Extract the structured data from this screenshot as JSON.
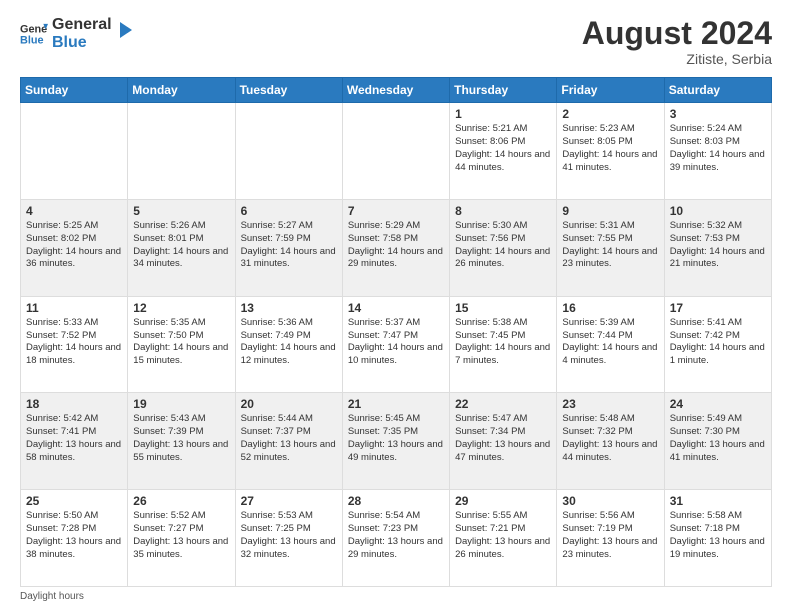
{
  "header": {
    "logo_line1": "General",
    "logo_line2": "Blue",
    "month_year": "August 2024",
    "location": "Zitiste, Serbia"
  },
  "days_of_week": [
    "Sunday",
    "Monday",
    "Tuesday",
    "Wednesday",
    "Thursday",
    "Friday",
    "Saturday"
  ],
  "weeks": [
    [
      {
        "day": "",
        "info": ""
      },
      {
        "day": "",
        "info": ""
      },
      {
        "day": "",
        "info": ""
      },
      {
        "day": "",
        "info": ""
      },
      {
        "day": "1",
        "info": "Sunrise: 5:21 AM\nSunset: 8:06 PM\nDaylight: 14 hours\nand 44 minutes."
      },
      {
        "day": "2",
        "info": "Sunrise: 5:23 AM\nSunset: 8:05 PM\nDaylight: 14 hours\nand 41 minutes."
      },
      {
        "day": "3",
        "info": "Sunrise: 5:24 AM\nSunset: 8:03 PM\nDaylight: 14 hours\nand 39 minutes."
      }
    ],
    [
      {
        "day": "4",
        "info": "Sunrise: 5:25 AM\nSunset: 8:02 PM\nDaylight: 14 hours\nand 36 minutes."
      },
      {
        "day": "5",
        "info": "Sunrise: 5:26 AM\nSunset: 8:01 PM\nDaylight: 14 hours\nand 34 minutes."
      },
      {
        "day": "6",
        "info": "Sunrise: 5:27 AM\nSunset: 7:59 PM\nDaylight: 14 hours\nand 31 minutes."
      },
      {
        "day": "7",
        "info": "Sunrise: 5:29 AM\nSunset: 7:58 PM\nDaylight: 14 hours\nand 29 minutes."
      },
      {
        "day": "8",
        "info": "Sunrise: 5:30 AM\nSunset: 7:56 PM\nDaylight: 14 hours\nand 26 minutes."
      },
      {
        "day": "9",
        "info": "Sunrise: 5:31 AM\nSunset: 7:55 PM\nDaylight: 14 hours\nand 23 minutes."
      },
      {
        "day": "10",
        "info": "Sunrise: 5:32 AM\nSunset: 7:53 PM\nDaylight: 14 hours\nand 21 minutes."
      }
    ],
    [
      {
        "day": "11",
        "info": "Sunrise: 5:33 AM\nSunset: 7:52 PM\nDaylight: 14 hours\nand 18 minutes."
      },
      {
        "day": "12",
        "info": "Sunrise: 5:35 AM\nSunset: 7:50 PM\nDaylight: 14 hours\nand 15 minutes."
      },
      {
        "day": "13",
        "info": "Sunrise: 5:36 AM\nSunset: 7:49 PM\nDaylight: 14 hours\nand 12 minutes."
      },
      {
        "day": "14",
        "info": "Sunrise: 5:37 AM\nSunset: 7:47 PM\nDaylight: 14 hours\nand 10 minutes."
      },
      {
        "day": "15",
        "info": "Sunrise: 5:38 AM\nSunset: 7:45 PM\nDaylight: 14 hours\nand 7 minutes."
      },
      {
        "day": "16",
        "info": "Sunrise: 5:39 AM\nSunset: 7:44 PM\nDaylight: 14 hours\nand 4 minutes."
      },
      {
        "day": "17",
        "info": "Sunrise: 5:41 AM\nSunset: 7:42 PM\nDaylight: 14 hours\nand 1 minute."
      }
    ],
    [
      {
        "day": "18",
        "info": "Sunrise: 5:42 AM\nSunset: 7:41 PM\nDaylight: 13 hours\nand 58 minutes."
      },
      {
        "day": "19",
        "info": "Sunrise: 5:43 AM\nSunset: 7:39 PM\nDaylight: 13 hours\nand 55 minutes."
      },
      {
        "day": "20",
        "info": "Sunrise: 5:44 AM\nSunset: 7:37 PM\nDaylight: 13 hours\nand 52 minutes."
      },
      {
        "day": "21",
        "info": "Sunrise: 5:45 AM\nSunset: 7:35 PM\nDaylight: 13 hours\nand 49 minutes."
      },
      {
        "day": "22",
        "info": "Sunrise: 5:47 AM\nSunset: 7:34 PM\nDaylight: 13 hours\nand 47 minutes."
      },
      {
        "day": "23",
        "info": "Sunrise: 5:48 AM\nSunset: 7:32 PM\nDaylight: 13 hours\nand 44 minutes."
      },
      {
        "day": "24",
        "info": "Sunrise: 5:49 AM\nSunset: 7:30 PM\nDaylight: 13 hours\nand 41 minutes."
      }
    ],
    [
      {
        "day": "25",
        "info": "Sunrise: 5:50 AM\nSunset: 7:28 PM\nDaylight: 13 hours\nand 38 minutes."
      },
      {
        "day": "26",
        "info": "Sunrise: 5:52 AM\nSunset: 7:27 PM\nDaylight: 13 hours\nand 35 minutes."
      },
      {
        "day": "27",
        "info": "Sunrise: 5:53 AM\nSunset: 7:25 PM\nDaylight: 13 hours\nand 32 minutes."
      },
      {
        "day": "28",
        "info": "Sunrise: 5:54 AM\nSunset: 7:23 PM\nDaylight: 13 hours\nand 29 minutes."
      },
      {
        "day": "29",
        "info": "Sunrise: 5:55 AM\nSunset: 7:21 PM\nDaylight: 13 hours\nand 26 minutes."
      },
      {
        "day": "30",
        "info": "Sunrise: 5:56 AM\nSunset: 7:19 PM\nDaylight: 13 hours\nand 23 minutes."
      },
      {
        "day": "31",
        "info": "Sunrise: 5:58 AM\nSunset: 7:18 PM\nDaylight: 13 hours\nand 19 minutes."
      }
    ]
  ],
  "footer": {
    "daylight_label": "Daylight hours"
  }
}
